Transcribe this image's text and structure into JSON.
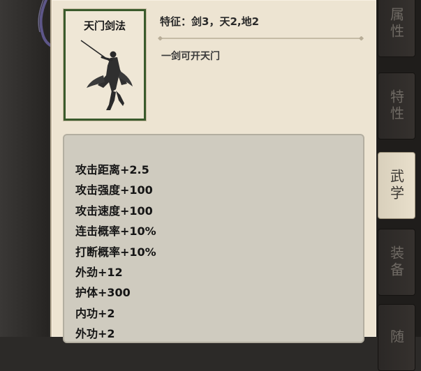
{
  "skill": {
    "name": "天门剑法",
    "feature_label": "特征：",
    "feature_values": "剑3，天2,地2",
    "description": "一剑可开天门",
    "frame_color": "#3a5a2c"
  },
  "attributes": [
    "攻击距离+2.5",
    "攻击强度+100",
    "攻击速度+100",
    "连击概率+10%",
    "打断概率+10%",
    "外劲+12",
    "护体+300",
    "内功+2",
    "外功+2"
  ],
  "tabs": [
    {
      "label": "属性",
      "active": false
    },
    {
      "label": "特性",
      "active": false
    },
    {
      "label": "武学",
      "active": true
    },
    {
      "label": "装备",
      "active": false
    },
    {
      "label": "随",
      "active": false
    }
  ],
  "icons": {
    "figure": "swordsman-figure-icon",
    "ornament": "ornament-icon"
  }
}
